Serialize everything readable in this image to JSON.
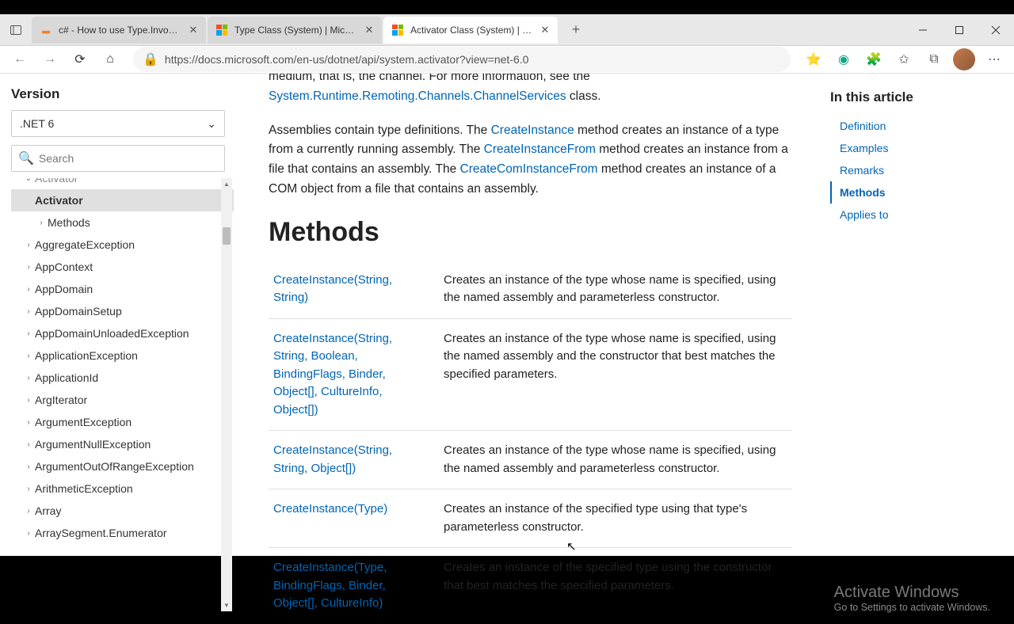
{
  "tabs": [
    {
      "title": "c# - How to use Type.InvokeMe…",
      "active": false
    },
    {
      "title": "Type Class (System) | Microsoft D",
      "active": false
    },
    {
      "title": "Activator Class (System) | Micros",
      "active": true
    }
  ],
  "address_bar": {
    "url": "https://docs.microsoft.com/en-us/dotnet/api/system.activator?view=net-6.0"
  },
  "left_panel": {
    "version_label": "Version",
    "version_value": ".NET 6",
    "search_placeholder": "Search",
    "tree": {
      "cutoff_top": "Activator",
      "selected": "Activator",
      "child": "Methods",
      "items": [
        "AggregateException",
        "AppContext",
        "AppDomain",
        "AppDomainSetup",
        "AppDomainUnloadedException",
        "ApplicationException",
        "ApplicationId",
        "ArgIterator",
        "ArgumentException",
        "ArgumentNullException",
        "ArgumentOutOfRangeException",
        "ArithmeticException",
        "Array",
        "ArraySegment<T>.Enumerator"
      ]
    }
  },
  "main": {
    "para1_pre": "medium, that is, the channel. For more information, see the ",
    "para1_link": "System.Runtime.Remoting.Channels.ChannelServices",
    "para1_post": " class.",
    "para2_1": "Assemblies contain type definitions. The ",
    "para2_link1": "CreateInstance",
    "para2_2": " method creates an instance of a type from a currently running assembly. The ",
    "para2_link2": "CreateInstanceFrom",
    "para2_3": " method creates an instance from a file that contains an assembly. The ",
    "para2_link3": "CreateComInstanceFrom",
    "para2_4": " method creates an instance of a COM object from a file that contains an assembly.",
    "heading": "Methods",
    "rows": [
      {
        "sig": "CreateInstance(String, String)",
        "desc": "Creates an instance of the type whose name is specified, using the named assembly and parameterless constructor."
      },
      {
        "sig": "CreateInstance(String, String, Boolean, BindingFlags, Binder, Object[], CultureInfo, Object[])",
        "desc": "Creates an instance of the type whose name is specified, using the named assembly and the constructor that best matches the specified parameters."
      },
      {
        "sig": "CreateInstance(String, String, Object[])",
        "desc": "Creates an instance of the type whose name is specified, using the named assembly and parameterless constructor."
      },
      {
        "sig": "CreateInstance(Type)",
        "desc": "Creates an instance of the specified type using that type's parameterless constructor."
      },
      {
        "sig": "CreateInstance(Type, BindingFlags, Binder, Object[], CultureInfo)",
        "desc": "Creates an instance of the specified type using the constructor that best matches the specified parameters."
      }
    ]
  },
  "toc": {
    "heading": "In this article",
    "items": [
      {
        "label": "Definition",
        "active": false
      },
      {
        "label": "Examples",
        "active": false
      },
      {
        "label": "Remarks",
        "active": false
      },
      {
        "label": "Methods",
        "active": true
      },
      {
        "label": "Applies to",
        "active": false
      }
    ]
  },
  "watermark": {
    "line1": "Activate Windows",
    "line2": "Go to Settings to activate Windows."
  }
}
